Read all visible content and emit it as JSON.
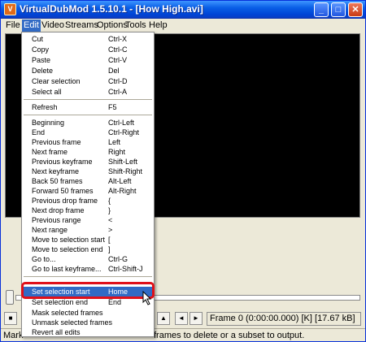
{
  "window": {
    "title": "VirtualDubMod 1.5.10.1 - [How High.avi]"
  },
  "title_buttons": {
    "minimize": "_",
    "maximize": "□",
    "close": "✕"
  },
  "menubar": [
    "File",
    "Edit",
    "Video",
    "Streams",
    "Options",
    "Tools",
    "Help"
  ],
  "edit_menu": {
    "items": [
      {
        "label": "Cut",
        "shortcut": "Ctrl-X"
      },
      {
        "label": "Copy",
        "shortcut": "Ctrl-C"
      },
      {
        "label": "Paste",
        "shortcut": "Ctrl-V"
      },
      {
        "label": "Delete",
        "shortcut": "Del"
      },
      {
        "label": "Clear selection",
        "shortcut": "Ctrl-D"
      },
      {
        "label": "Select all",
        "shortcut": "Ctrl-A"
      },
      {
        "label": "Refresh",
        "shortcut": "F5"
      },
      {
        "label": "Beginning",
        "shortcut": "Ctrl-Left"
      },
      {
        "label": "End",
        "shortcut": "Ctrl-Right"
      },
      {
        "label": "Previous frame",
        "shortcut": "Left"
      },
      {
        "label": "Next frame",
        "shortcut": "Right"
      },
      {
        "label": "Previous keyframe",
        "shortcut": "Shift-Left"
      },
      {
        "label": "Next keyframe",
        "shortcut": "Shift-Right"
      },
      {
        "label": "Back 50 frames",
        "shortcut": "Alt-Left"
      },
      {
        "label": "Forward 50 frames",
        "shortcut": "Alt-Right"
      },
      {
        "label": "Previous drop frame",
        "shortcut": "{"
      },
      {
        "label": "Next drop frame",
        "shortcut": "}"
      },
      {
        "label": "Previous range",
        "shortcut": "<"
      },
      {
        "label": "Next range",
        "shortcut": ">"
      },
      {
        "label": "Move to selection start",
        "shortcut": "["
      },
      {
        "label": "Move to selection end",
        "shortcut": "]"
      },
      {
        "label": "Go to...",
        "shortcut": "Ctrl-G"
      },
      {
        "label": "Go to last keyframe...",
        "shortcut": "Ctrl-Shift-J"
      },
      {
        "label": "Set selection start",
        "shortcut": "Home"
      },
      {
        "label": "Set selection end",
        "shortcut": "End"
      },
      {
        "label": "Mask selected frames",
        "shortcut": ""
      },
      {
        "label": "Unmask selected frames",
        "shortcut": ""
      },
      {
        "label": "Revert all edits",
        "shortcut": ""
      }
    ],
    "highlighted_item": "Set selection start"
  },
  "frame_readout": "Frame 0 (0:00:00.000) [K] [17.67 kB]",
  "status": {
    "left": "Mark",
    "right": "frames to delete or a subset to output."
  },
  "colors": {
    "highlight": "#316ac5",
    "callout": "#e0101a",
    "titlebar": "#0a5fe6"
  }
}
